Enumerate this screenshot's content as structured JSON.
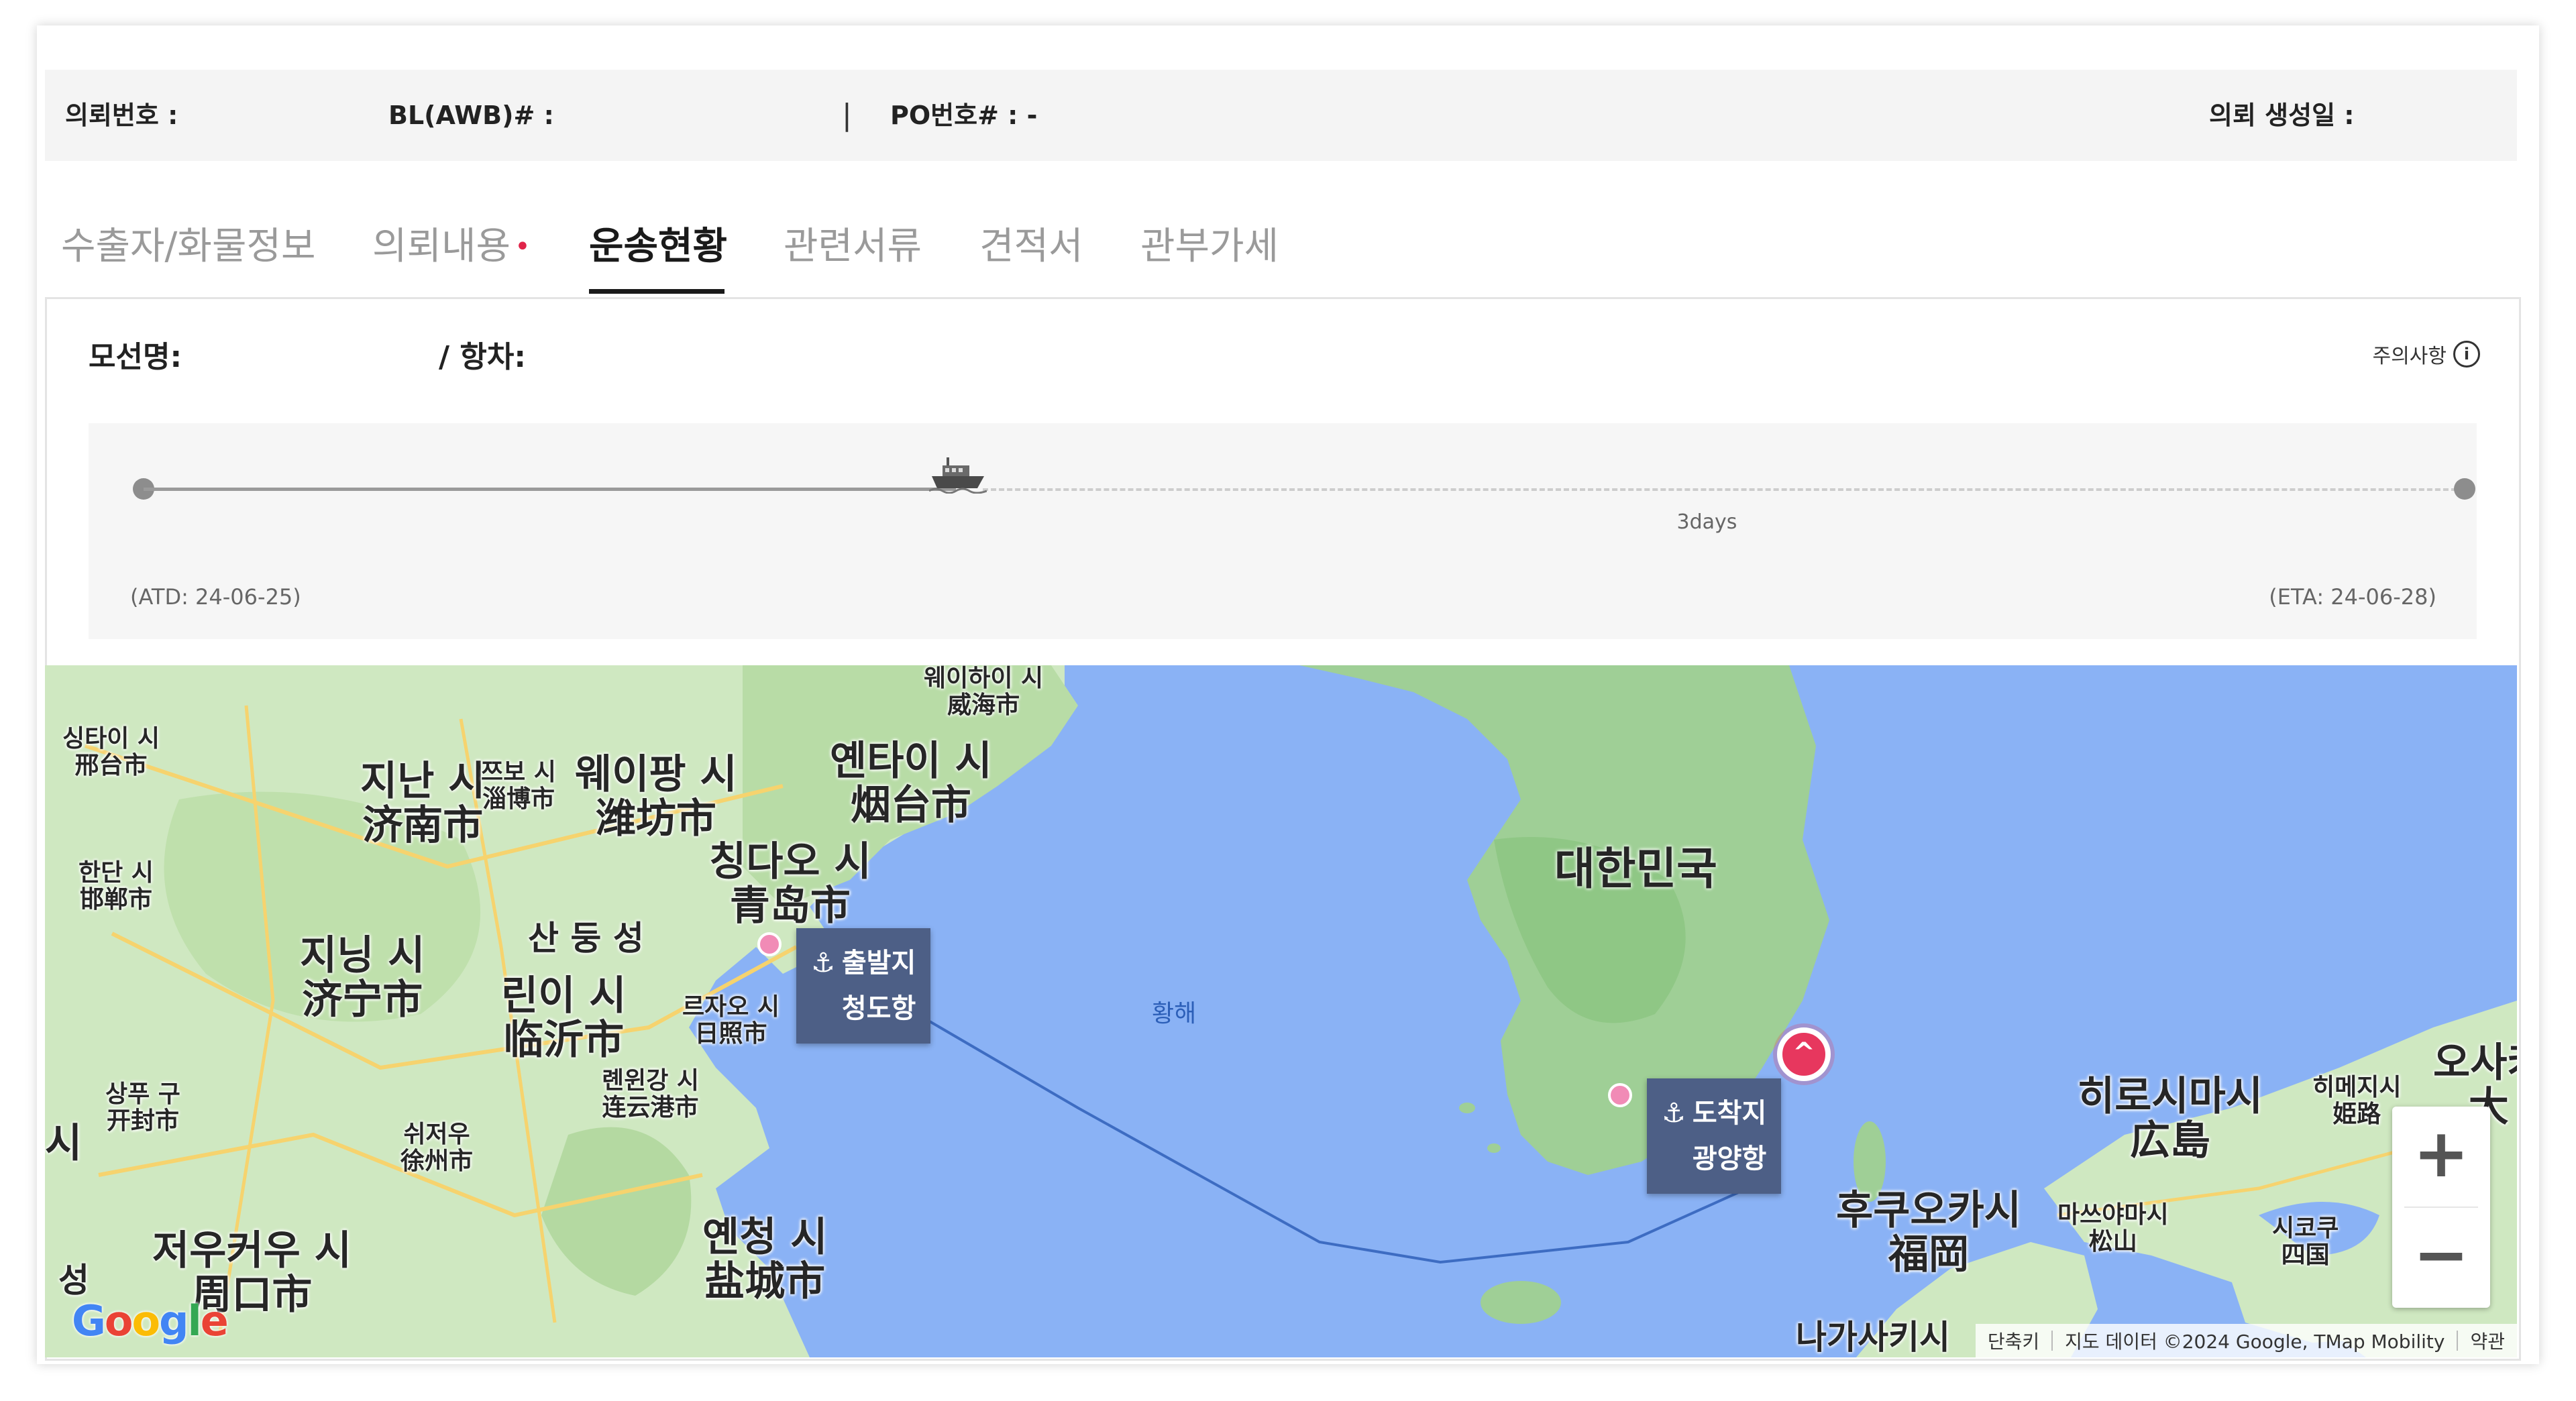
{
  "header": {
    "request_no_label": "의뢰번호 :",
    "bl_label": "BL(AWB)# :",
    "separator": "|",
    "po_label": "PO번호# : -",
    "created_label": "의뢰 생성일 :"
  },
  "tabs": [
    {
      "label": "수출자/화물정보",
      "active": false
    },
    {
      "label": "의뢰내용",
      "active": false,
      "required_mark": "•"
    },
    {
      "label": "운송현황",
      "active": true
    },
    {
      "label": "관련서류",
      "active": false
    },
    {
      "label": "견적서",
      "active": false
    },
    {
      "label": "관부가세",
      "active": false
    }
  ],
  "panel": {
    "vessel_label": "모선명:",
    "voyage_label": "/ 항차:",
    "notice_label": "주의사항",
    "notice_icon": "info-icon",
    "progress": {
      "remaining": "3days",
      "atd": "(ATD: 24-06-25)",
      "eta": "(ETA: 24-06-28)",
      "progress_fraction": 0.35,
      "ship_icon": "ship-icon"
    }
  },
  "map": {
    "places": {
      "xingtai": "싱타이 시",
      "xingtai_han": "邢台市",
      "jinan": "지난 시",
      "jinan_han": "济南市",
      "zibo": "쯔보 시",
      "zibo_han": "淄博市",
      "weifang": "웨이팡 시",
      "weifang_han": "潍坊市",
      "yantai": "옌타이 시",
      "yantai_han": "烟台市",
      "weihai": "웨이하이 시",
      "weihai_han": "威海市",
      "qingdao": "칭다오 시",
      "qingdao_han": "青岛市",
      "handan": "한단 시",
      "handan_han": "邯郸市",
      "jining": "지닝 시",
      "jining_han": "济宁市",
      "shandong": "산 둥 성",
      "linyi": "린이 시",
      "linyi_han": "临沂市",
      "rizhao": "르자오 시",
      "rizhao_han": "日照市",
      "lianyungang": "롄윈강 시",
      "lianyungang_han": "连云港市",
      "xuzhou": "쉬저우",
      "xuzhou_han": "徐州市",
      "shangqiu": "상푸 구",
      "shangqiu_han": "开封市",
      "zhoukou": "저우커우 시",
      "zhoukou_han": "周口市",
      "yancheng": "옌청 시",
      "yancheng_han": "盐城市",
      "hiroshima": "히로시마시",
      "hiroshima_han": "広島",
      "himeji": "히메지시",
      "himeji_han": "姫路",
      "fukuoka": "후쿠오카시",
      "fukuoka_han": "福岡",
      "matsuyama": "마쓰야마시",
      "matsuyama_han": "松山",
      "shikoku": "시코쿠",
      "shikoku_han": "四国",
      "osaka": "오사카",
      "osaka_han": "大",
      "nagasaki": "나가사키시"
    },
    "edge_labels": {
      "left_si_1": "시",
      "left_si_2": "성"
    },
    "sea_label": "황해",
    "country_label": "대한민국",
    "origin": {
      "prefix": "출발지",
      "name": "청도항"
    },
    "destination": {
      "prefix": "도착지",
      "name": "광양항"
    },
    "anchor_icon": "⚓",
    "zoom_in": "+",
    "zoom_out": "−",
    "google_logo": "Google",
    "attribution": {
      "shortcuts": "단축키",
      "map_data": "지도 데이터 ©2024 Google, TMap Mobility",
      "terms": "약관"
    },
    "colors": {
      "water": "#8ab2f5",
      "land": "#c7e6b8",
      "korea": "#9fcf96",
      "route": "#3d6cc2",
      "marker": "#e7375e"
    }
  }
}
